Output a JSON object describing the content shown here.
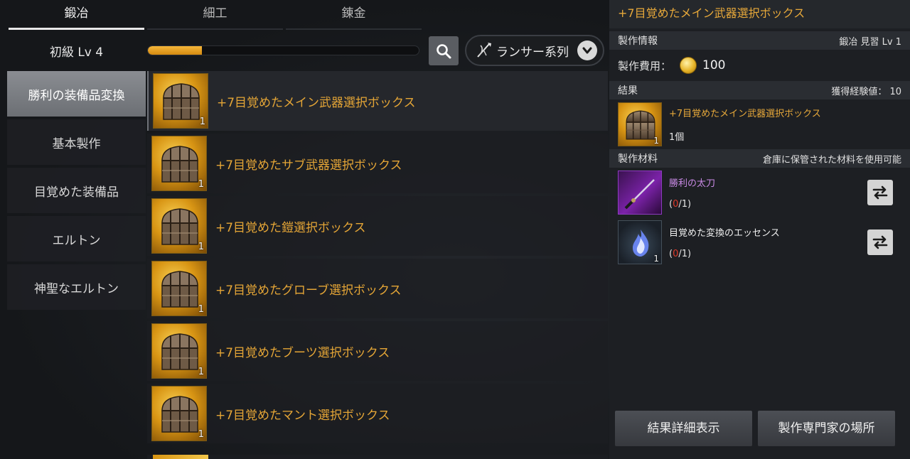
{
  "tabs": [
    {
      "label": "鍛冶",
      "active": true
    },
    {
      "label": "細工",
      "active": false
    },
    {
      "label": "錬金",
      "active": false
    }
  ],
  "level": {
    "label": "初級 Lv 4",
    "xp_progress": 0.2
  },
  "class_filter": {
    "label": "ランサー系列",
    "icon": "lancer-class-icon"
  },
  "categories": [
    {
      "label": "勝利の装備品変換",
      "active": true
    },
    {
      "label": "基本製作",
      "active": false
    },
    {
      "label": "目覚めた装備品",
      "active": false
    },
    {
      "label": "エルトン",
      "active": false
    },
    {
      "label": "神聖なエルトン",
      "active": false
    }
  ],
  "recipes": [
    {
      "name": "+7目覚めたメイン武器選択ボックス",
      "qty": "1",
      "active": true
    },
    {
      "name": "+7目覚めたサブ武器選択ボックス",
      "qty": "1",
      "active": false
    },
    {
      "name": "+7目覚めた鎧選択ボックス",
      "qty": "1",
      "active": false
    },
    {
      "name": "+7目覚めたグローブ選択ボックス",
      "qty": "1",
      "active": false
    },
    {
      "name": "+7目覚めたブーツ選択ボックス",
      "qty": "1",
      "active": false
    },
    {
      "name": "+7目覚めたマント選択ボックス",
      "qty": "1",
      "active": false
    }
  ],
  "detail": {
    "title": "+7目覚めたメイン武器選択ボックス",
    "info_header": "製作情報",
    "info_right": "鍛冶 見習 Lv 1",
    "cost_label": "製作費用：",
    "cost_value": "100",
    "result_header": "結果",
    "result_right": "獲得経験値： 10",
    "result_item": {
      "name": "+7目覚めたメイン武器選択ボックス",
      "count": "1個",
      "qty": "1"
    },
    "materials_header": "製作材料",
    "materials_right": "倉庫に保管された材料を使用可能",
    "materials": [
      {
        "name": "勝利の太刀",
        "have": "0",
        "need": "/1",
        "qty": "",
        "icon": "katana-icon"
      },
      {
        "name": "目覚めた変換のエッセンス",
        "have": "0",
        "need": "/1",
        "qty": "1",
        "icon": "blue-flame-essence-icon"
      }
    ],
    "buttons": {
      "details": "結果詳細表示",
      "location": "製作専門家の場所"
    }
  },
  "colors": {
    "accent_gold": "#e8a93a",
    "progress": "#f6b73a",
    "missing_material": "#e03a2a"
  }
}
